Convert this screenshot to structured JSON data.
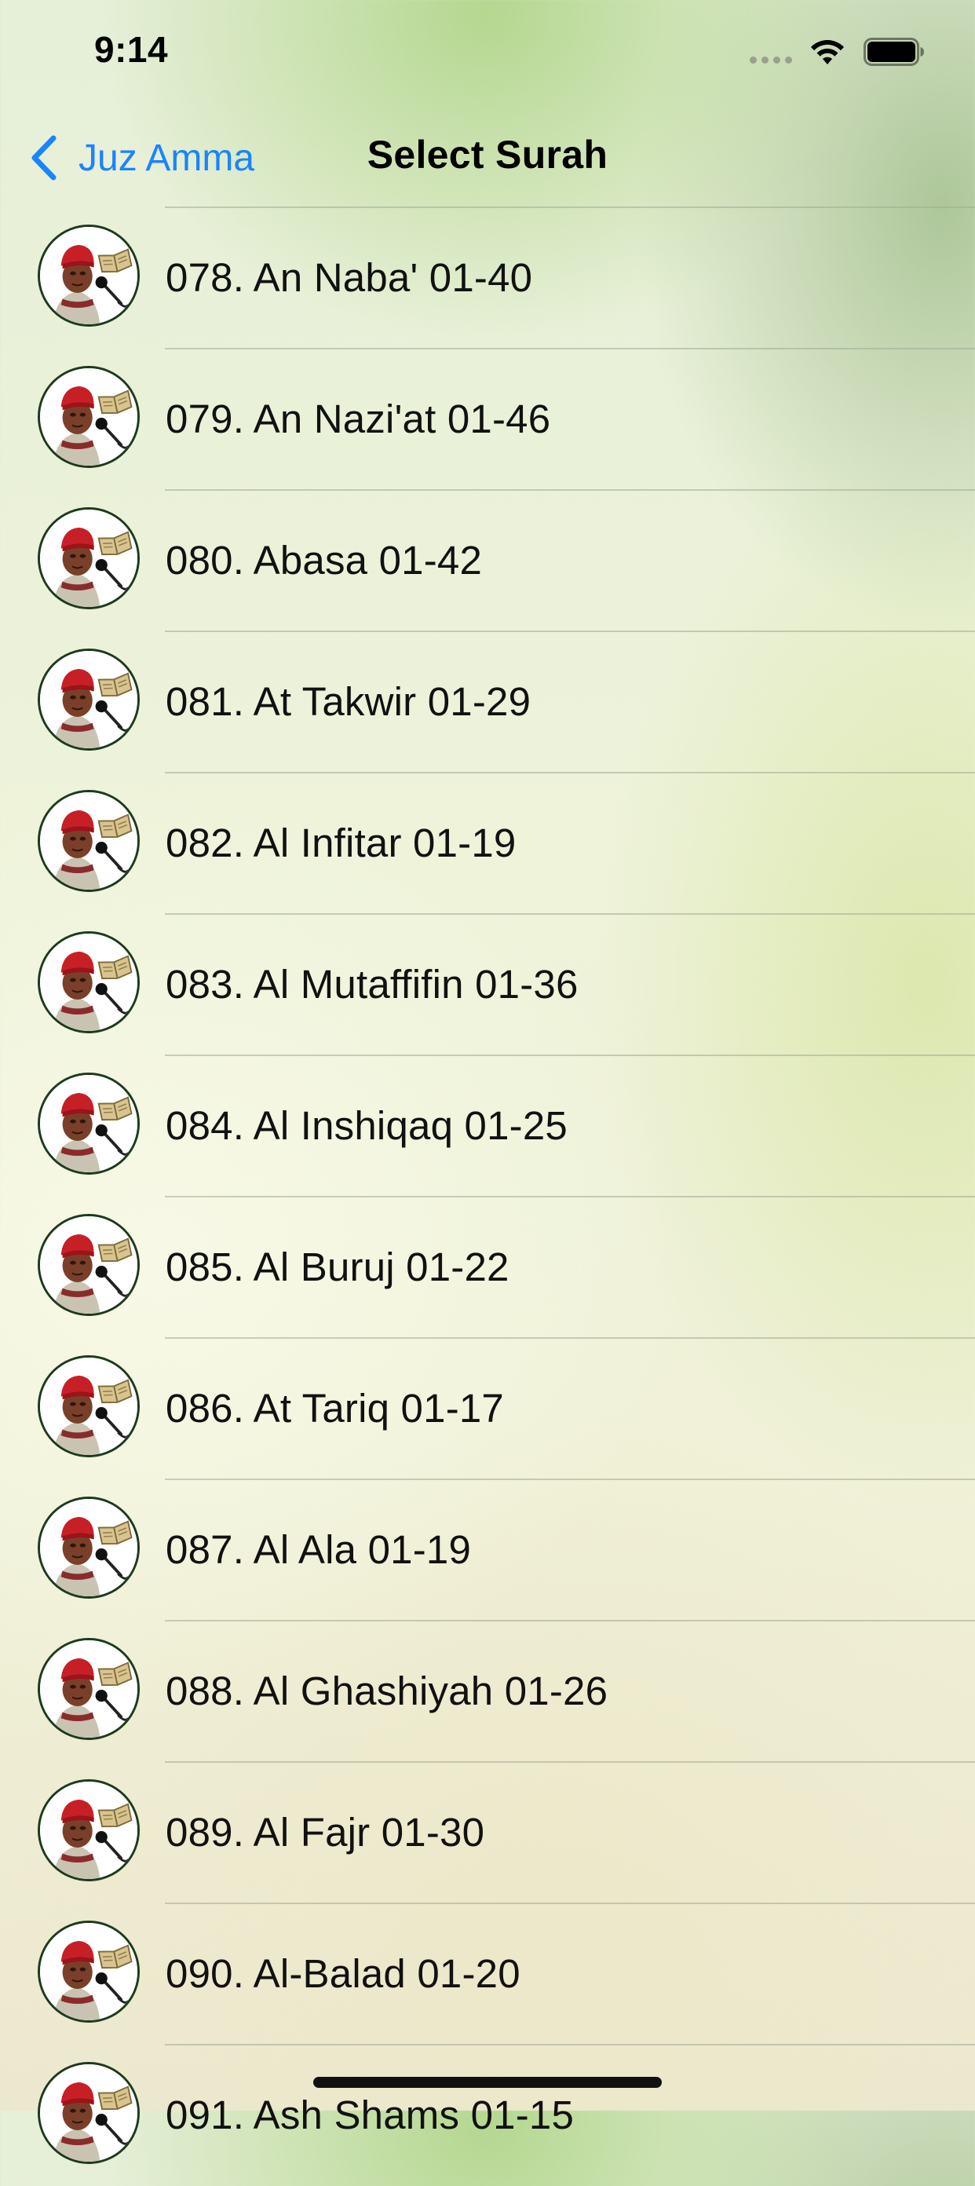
{
  "status_bar": {
    "time": "9:14",
    "icons": [
      "cellular-dots-icon",
      "wifi-icon",
      "battery-icon"
    ]
  },
  "nav": {
    "back_label": "Juz Amma",
    "back_icon": "chevron-left-icon",
    "title": "Select Surah"
  },
  "colors": {
    "accent": "#1a84ff",
    "text": "#111111"
  },
  "surahs": [
    {
      "label": "078. An Naba' 01-40",
      "icon": "reciter-avatar"
    },
    {
      "label": "079. An Nazi'at 01-46",
      "icon": "reciter-avatar"
    },
    {
      "label": "080. Abasa 01-42",
      "icon": "reciter-avatar"
    },
    {
      "label": "081. At Takwir 01-29",
      "icon": "reciter-avatar"
    },
    {
      "label": "082. Al Infitar 01-19",
      "icon": "reciter-avatar"
    },
    {
      "label": "083. Al Mutaffifin 01-36",
      "icon": "reciter-avatar"
    },
    {
      "label": "084. Al Inshiqaq 01-25",
      "icon": "reciter-avatar"
    },
    {
      "label": "085. Al Buruj 01-22",
      "icon": "reciter-avatar"
    },
    {
      "label": "086. At Tariq 01-17",
      "icon": "reciter-avatar"
    },
    {
      "label": "087. Al Ala 01-19",
      "icon": "reciter-avatar"
    },
    {
      "label": "088. Al Ghashiyah 01-26",
      "icon": "reciter-avatar"
    },
    {
      "label": "089. Al Fajr 01-30",
      "icon": "reciter-avatar"
    },
    {
      "label": "090. Al-Balad 01-20",
      "icon": "reciter-avatar"
    },
    {
      "label": "091. Ash Shams 01-15",
      "icon": "reciter-avatar"
    }
  ]
}
